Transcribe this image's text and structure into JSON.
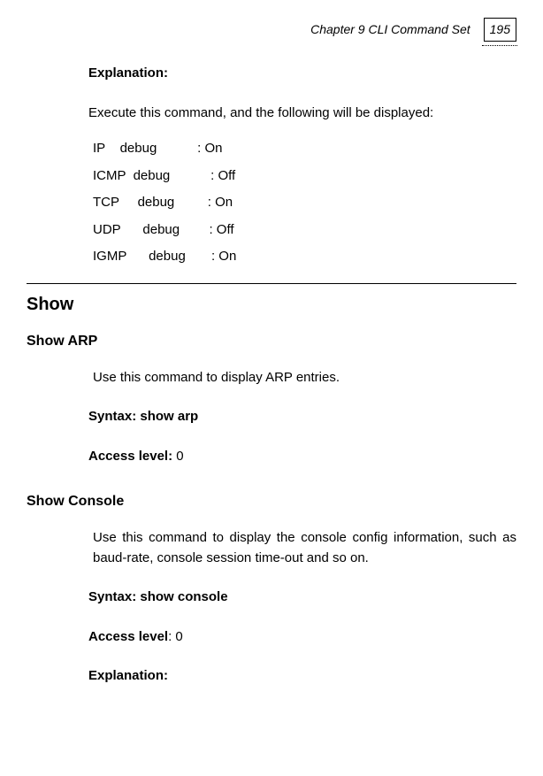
{
  "header": {
    "chapter": "Chapter 9 CLI Command Set",
    "page": "195"
  },
  "explanation1": {
    "label": "Explanation:",
    "text": "Execute this command, and the following will be displayed:"
  },
  "debug": {
    "row1": "IP    debug           : On",
    "row2": "ICMP  debug           : Off",
    "row3": "TCP     debug         : On",
    "row4": "UDP      debug        : Off",
    "row5": "IGMP      debug       : On"
  },
  "show": {
    "heading": "Show"
  },
  "showArp": {
    "heading": "Show ARP",
    "desc": "Use this command to display ARP entries.",
    "syntaxLabel": "Syntax: show arp",
    "accessLabel": "Access level: ",
    "accessValue": "0"
  },
  "showConsole": {
    "heading": "Show Console",
    "desc": "Use this command to display the console config information, such as baud-rate, console session time-out and so on.",
    "syntaxLabel": "Syntax: show console",
    "accessLabel": "Access level",
    "accessValue": ": 0",
    "explanationLabel": "Explanation:"
  }
}
